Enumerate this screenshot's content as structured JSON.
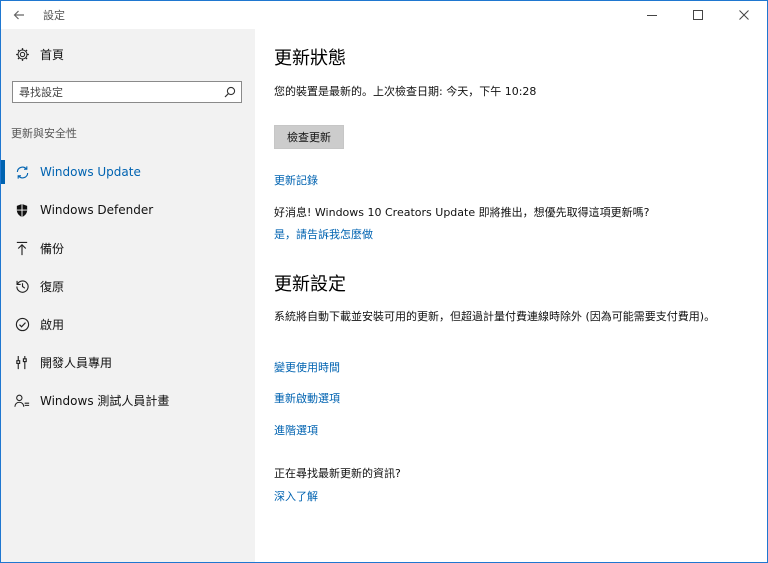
{
  "window": {
    "title": "設定"
  },
  "sidebar": {
    "home_label": "首頁",
    "search_placeholder": "尋找設定",
    "section_label": "更新與安全性",
    "items": [
      {
        "label": "Windows Update",
        "icon": "sync-icon",
        "active": true
      },
      {
        "label": "Windows Defender",
        "icon": "shield-icon",
        "active": false
      },
      {
        "label": "備份",
        "icon": "backup-arrow-icon",
        "active": false
      },
      {
        "label": "復原",
        "icon": "history-icon",
        "active": false
      },
      {
        "label": "啟用",
        "icon": "check-circle-icon",
        "active": false
      },
      {
        "label": "開發人員專用",
        "icon": "developer-tools-icon",
        "active": false
      },
      {
        "label": "Windows 測試人員計畫",
        "icon": "insider-person-icon",
        "active": false
      }
    ]
  },
  "main": {
    "status_heading": "更新狀態",
    "status_text": "您的裝置是最新的。上次檢查日期: 今天，下午 10:28",
    "check_button": "檢查更新",
    "history_link": "更新記錄",
    "promo_text": "好消息! Windows 10 Creators Update 即將推出，想優先取得這項更新嗎?",
    "promo_link": "是，請告訴我怎麼做",
    "settings_heading": "更新設定",
    "settings_text": "系統將自動下載並安裝可用的更新，但超過計量付費連線時除外 (因為可能需要支付費用)。",
    "active_hours_link": "變更使用時間",
    "restart_options_link": "重新啟動選項",
    "advanced_link": "進階選項",
    "info_question": "正在尋找最新更新的資訊?",
    "learn_more_link": "深入了解"
  },
  "colors": {
    "accent": "#0063b1",
    "sidebar_bg": "#f2f2f2",
    "button_bg": "#cccccc"
  }
}
